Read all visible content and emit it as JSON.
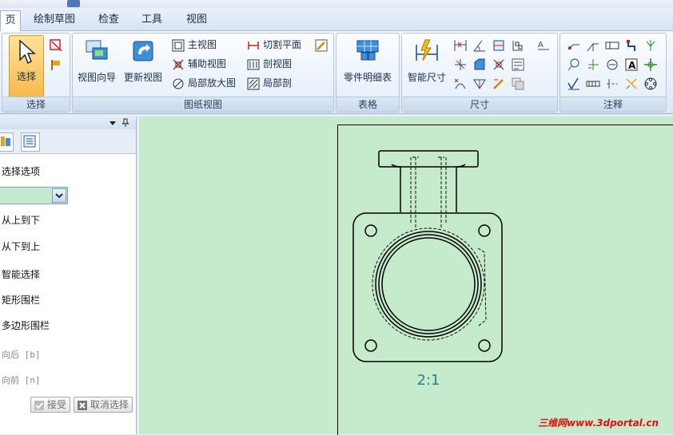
{
  "tabs": [
    "页",
    "绘制草图",
    "检查",
    "工具",
    "视图"
  ],
  "ribbon": {
    "select_group": {
      "label": "选择",
      "button": "选择"
    },
    "drawing_views_group": {
      "label": "图纸视图",
      "view_wizard": "视图向导",
      "update_views": "更新视图",
      "principal_view": "主视图",
      "auxiliary_view": "辅助视图",
      "detail_view": "局部放大图",
      "cutting_plane": "切割平面",
      "section_view": "剖视图",
      "broken_out_section": "局部剖"
    },
    "tables_group": {
      "label": "表格",
      "parts_list": "零件明细表"
    },
    "dimension_group": {
      "label": "尺寸",
      "smart_dimension": "智能尺寸"
    },
    "annotation_group": {
      "label": "注释"
    }
  },
  "panel": {
    "title": "选择选项",
    "items": [
      "从上到下",
      "从下到上",
      "智能选择",
      "矩形围栏",
      "多边形围栏"
    ],
    "disabled_items": [
      "向后 [b]",
      "向前 [n]"
    ],
    "accept": "接受",
    "cancel": "取消选择"
  },
  "drawing": {
    "scale_label": "2:1"
  },
  "watermark": "三维网www.3dportal.cn",
  "colors": {
    "canvas": "#c6ebcc",
    "scale_text": "#2a7f8f",
    "accent": "#f2b64a"
  }
}
